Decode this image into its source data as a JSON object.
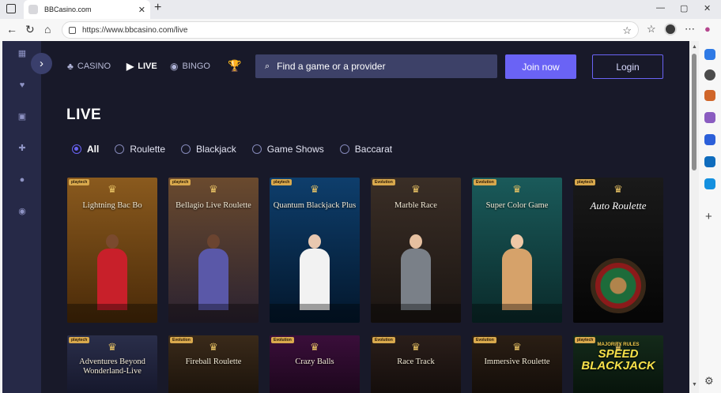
{
  "browser": {
    "tab_title": "BBCasino.com",
    "tab_close": "✕",
    "new_tab": "+",
    "url": "https://www.bbcasino.com/live",
    "window_controls": [
      "—",
      "▢",
      "✕"
    ]
  },
  "site": {
    "nav": [
      {
        "label": "CASINO",
        "icon": "casino-icon",
        "glyph": "♣",
        "active": false
      },
      {
        "label": "LIVE",
        "icon": "live-icon",
        "glyph": "▶",
        "active": true
      },
      {
        "label": "BINGO",
        "icon": "bingo-icon",
        "glyph": "◉",
        "active": false
      }
    ],
    "trophy_glyph": "🏆",
    "search_placeholder": "Find a game or a provider",
    "join_label": "Join now",
    "login_label": "Login",
    "expand_glyph": "›"
  },
  "page": {
    "title": "LIVE",
    "filters": [
      {
        "label": "All",
        "selected": true
      },
      {
        "label": "Roulette",
        "selected": false
      },
      {
        "label": "Blackjack",
        "selected": false
      },
      {
        "label": "Game Shows",
        "selected": false
      },
      {
        "label": "Baccarat",
        "selected": false
      }
    ]
  },
  "games": [
    {
      "title": "Lightning Bac Bo",
      "brand": "playtech",
      "bg": "#8a5a1e",
      "bg2": "#4a2a08",
      "fig": "#c8202a",
      "skin": "#7a4a2e",
      "kind": "dealer"
    },
    {
      "title": "Bellagio Live Roulette",
      "brand": "playtech",
      "bg": "#6a4a2e",
      "bg2": "#2b2230",
      "fig": "#5a58a8",
      "skin": "#6b4430",
      "kind": "dealer"
    },
    {
      "title": "Quantum Blackjack Plus",
      "brand": "playtech",
      "bg": "#0e3e6c",
      "bg2": "#03172c",
      "fig": "#f2f2f2",
      "skin": "#e8c8b0",
      "kind": "dealer"
    },
    {
      "title": "Marble Race",
      "brand": "Evolution",
      "bg": "#3a2e26",
      "bg2": "#1b1512",
      "fig": "#7a8088",
      "skin": "#e6c0a0",
      "kind": "dealer"
    },
    {
      "title": "Super Color Game",
      "brand": "Evolution",
      "bg": "#1a5a5a",
      "bg2": "#0a2a2a",
      "fig": "#d6a26a",
      "skin": "#efc8a6",
      "kind": "dealer"
    },
    {
      "title": "Auto Roulette",
      "brand": "playtech",
      "bg": "#1a1a1a",
      "bg2": "#050505",
      "fig": "#1d6b3a",
      "skin": "#b0844c",
      "kind": "wheel"
    },
    {
      "title": "Adventures Beyond Wonderland-Live",
      "brand": "playtech",
      "bg": "#2a2e4a",
      "bg2": "#14162a",
      "fig": "#333",
      "skin": "#333",
      "kind": "none"
    },
    {
      "title": "Fireball Roulette",
      "brand": "Evolution",
      "bg": "#3a2a1a",
      "bg2": "#1a120a",
      "fig": "#333",
      "skin": "#333",
      "kind": "none"
    },
    {
      "title": "Crazy Balls",
      "brand": "Evolution",
      "bg": "#3a0e3a",
      "bg2": "#1a061a",
      "fig": "#333",
      "skin": "#333",
      "kind": "none"
    },
    {
      "title": "Race Track",
      "brand": "Evolution",
      "bg": "#2a1e1a",
      "bg2": "#120c0a",
      "fig": "#333",
      "skin": "#333",
      "kind": "none"
    },
    {
      "title": "Immersive Roulette",
      "brand": "Evolution",
      "bg": "#2a1e14",
      "bg2": "#120c08",
      "fig": "#333",
      "skin": "#333",
      "kind": "none"
    },
    {
      "title": "SPEED BLACKJACK",
      "subtitle": "MAJORITY RULES",
      "brand": "playtech",
      "bg": "#142a1a",
      "bg2": "#06120a",
      "fig": "#333",
      "skin": "#333",
      "kind": "speed"
    }
  ],
  "colors": {
    "accent": "#6a63f5",
    "page_bg": "#181929",
    "sidebar_bg": "#262947",
    "search_bg": "#3d4168"
  }
}
